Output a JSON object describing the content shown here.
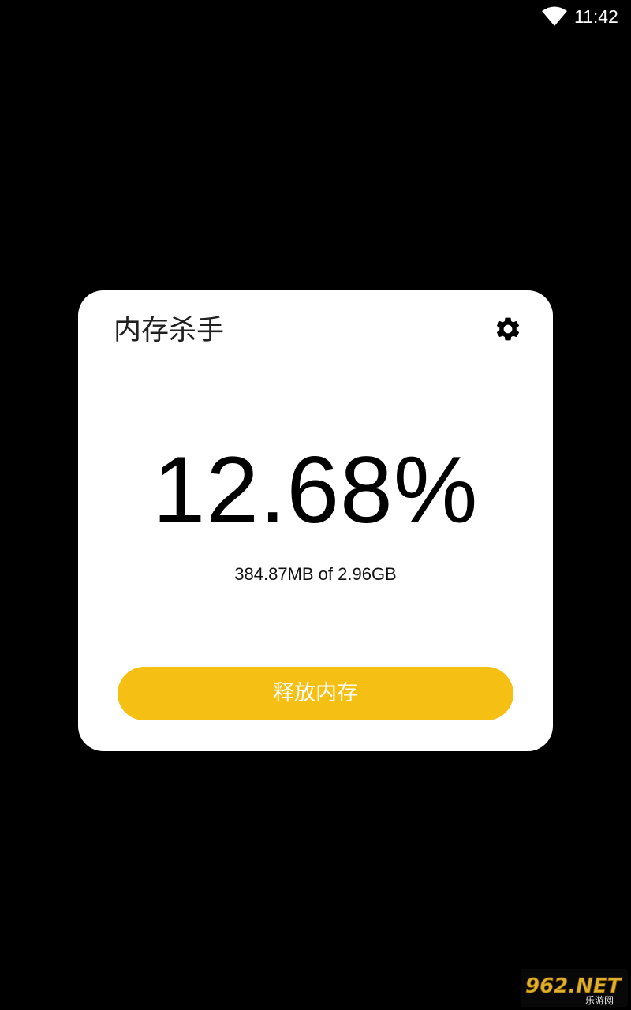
{
  "status_bar": {
    "time": "11:42",
    "wifi_icon": "wifi-icon"
  },
  "card": {
    "title": "内存杀手",
    "settings_icon": "gear-icon",
    "usage_percent": "12.68%",
    "usage_detail": "384.87MB of 2.96GB",
    "release_button_label": "释放内存"
  },
  "watermark": {
    "brand": "962.NET",
    "sub": "乐游网"
  },
  "colors": {
    "background": "#000000",
    "card": "#ffffff",
    "accent": "#f5bf14",
    "text": "#000000"
  }
}
